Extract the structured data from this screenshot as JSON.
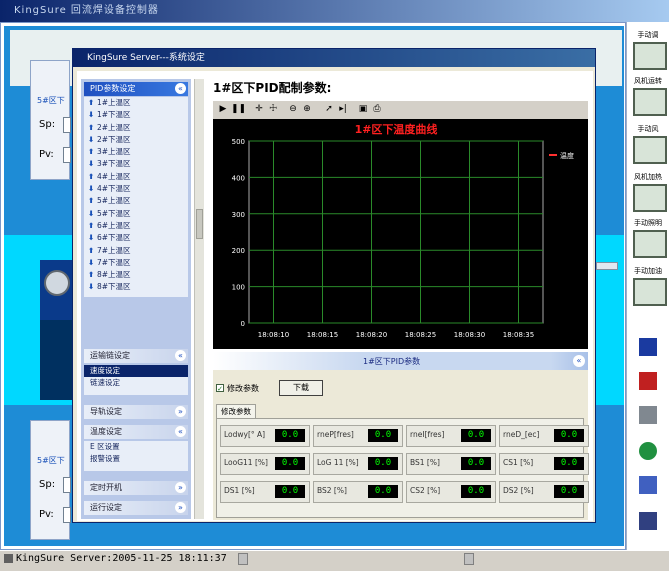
{
  "bg": {
    "title": "KingSure  回流焊设备控制器",
    "zone_top": "5#区下",
    "zone_bottom": "5#区下",
    "sp_label": "Sp:",
    "pv_label": "Pv:"
  },
  "right_panel": {
    "buttons": [
      "手动调",
      "风机运转",
      "手动风",
      "风机加热",
      "手动照明",
      "手动加油"
    ]
  },
  "status": {
    "text": "KingSure Server:2005-11-25 18:11:37"
  },
  "dialog": {
    "title": "KingSure Server---系统设定",
    "main_title": "1#区下PID配制参数:",
    "nav": {
      "pid_header": "PID参数设定",
      "pid_items": [
        {
          "dir": "up",
          "label": "1#上温区"
        },
        {
          "dir": "down",
          "label": "1#下温区"
        },
        {
          "dir": "up",
          "label": "2#上温区"
        },
        {
          "dir": "down",
          "label": "2#下温区"
        },
        {
          "dir": "up",
          "label": "3#上温区"
        },
        {
          "dir": "down",
          "label": "3#下温区"
        },
        {
          "dir": "up",
          "label": "4#上温区"
        },
        {
          "dir": "down",
          "label": "4#下温区"
        },
        {
          "dir": "up",
          "label": "5#上温区"
        },
        {
          "dir": "down",
          "label": "5#下温区"
        },
        {
          "dir": "up",
          "label": "6#上温区"
        },
        {
          "dir": "down",
          "label": "6#下温区"
        },
        {
          "dir": "up",
          "label": "7#上温区"
        },
        {
          "dir": "down",
          "label": "7#下温区"
        },
        {
          "dir": "up",
          "label": "8#上温区"
        },
        {
          "dir": "down",
          "label": "8#下温区"
        }
      ],
      "section2_header": "运输链设定",
      "section2_items": [
        "速度设定",
        "链速设定"
      ],
      "section3_header": "导轨设定",
      "section4_header": "温度设定",
      "section4_items": [
        "E 区设置",
        "报警设置"
      ],
      "section5_header": "定时开机",
      "section6_header": "运行设定"
    },
    "group_title": "1#区下PID参数",
    "modify_checkbox": "修改参数",
    "download_button": "下载",
    "tab_label": "修改参数",
    "fields": [
      {
        "label": "Lodwy[° A]",
        "value": "0.0"
      },
      {
        "label": "rneP[fres]",
        "value": "0.0"
      },
      {
        "label": "rneI[fres]",
        "value": "0.0"
      },
      {
        "label": "rneD_[ec]",
        "value": "0.0"
      },
      {
        "label": "LooG11 [%]",
        "value": "0.0"
      },
      {
        "label": "LoG 11 [%]",
        "value": "0.0"
      },
      {
        "label": "BS1 [%]",
        "value": "0.0"
      },
      {
        "label": "CS1 [%]",
        "value": "0.0"
      },
      {
        "label": "DS1 [%]",
        "value": "0.0"
      },
      {
        "label": "BS2 [%]",
        "value": "0.0"
      },
      {
        "label": "CS2 [%]",
        "value": "0.0"
      },
      {
        "label": "DS2 [%]",
        "value": "0.0"
      }
    ]
  },
  "chart_data": {
    "type": "line",
    "title": "1#区下温度曲线",
    "xlabel": "",
    "ylabel": "",
    "x_ticks": [
      "18:08:10",
      "18:08:15",
      "18:08:20",
      "18:08:25",
      "18:08:30",
      "18:08:35"
    ],
    "y_ticks": [
      0,
      100,
      200,
      300,
      400,
      500
    ],
    "ylim": [
      0,
      500
    ],
    "grid": true,
    "legend": "top-right",
    "series": [
      {
        "name": "温度",
        "values": [],
        "color": "#ff3030"
      }
    ],
    "colors": {
      "background": "#000000",
      "grid": "#2a8a2a",
      "title": "#ff2020"
    }
  }
}
